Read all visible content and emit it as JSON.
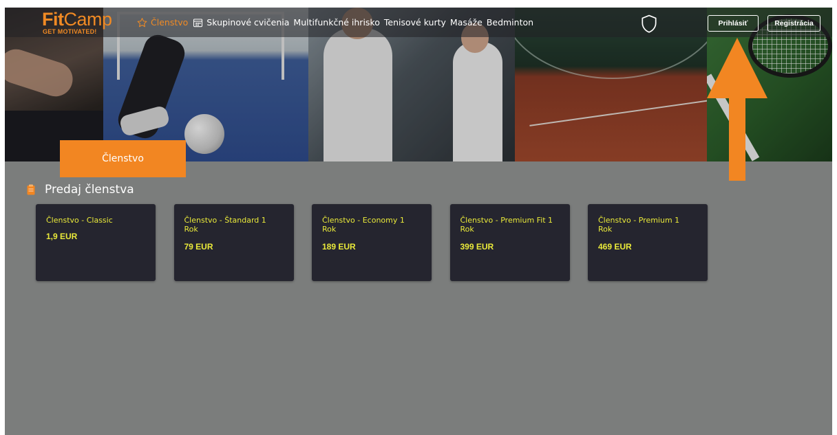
{
  "brand": {
    "name_bold": "Fit",
    "name_light": "Camp",
    "tagline": "GET MOTIVATED!"
  },
  "nav": {
    "links": [
      {
        "label": "Členstvo",
        "icon": "star-outline-icon",
        "active": true
      },
      {
        "label": "Skupinové cvičenia",
        "icon": "calendar-icon",
        "active": false
      },
      {
        "label": "Multifunkčné ihrisko",
        "active": false
      },
      {
        "label": "Tenisové kurty",
        "active": false
      },
      {
        "label": "Masáže",
        "active": false
      },
      {
        "label": "Bedminton",
        "active": false
      }
    ],
    "shield_icon": "shield-icon",
    "login": "Prihlásiť",
    "register": "Registrácia"
  },
  "tab": {
    "label": "Členstvo"
  },
  "section": {
    "title": "Predaj členstva",
    "icon": "clipboard-icon"
  },
  "cards": [
    {
      "name": "Členstvo - Classic",
      "price": "1,9 EUR"
    },
    {
      "name": "Členstvo - Štandard 1 Rok",
      "price": "79 EUR"
    },
    {
      "name": "Členstvo - Economy 1 Rok",
      "price": "189 EUR"
    },
    {
      "name": "Členstvo - Premium Fit 1 Rok",
      "price": "399 EUR"
    },
    {
      "name": "Členstvo - Premium 1 Rok",
      "price": "469 EUR"
    }
  ],
  "colors": {
    "accent": "#f28622",
    "card_bg": "#25252f",
    "card_text": "#eaea3a",
    "page_bg": "#7b7d7c"
  }
}
